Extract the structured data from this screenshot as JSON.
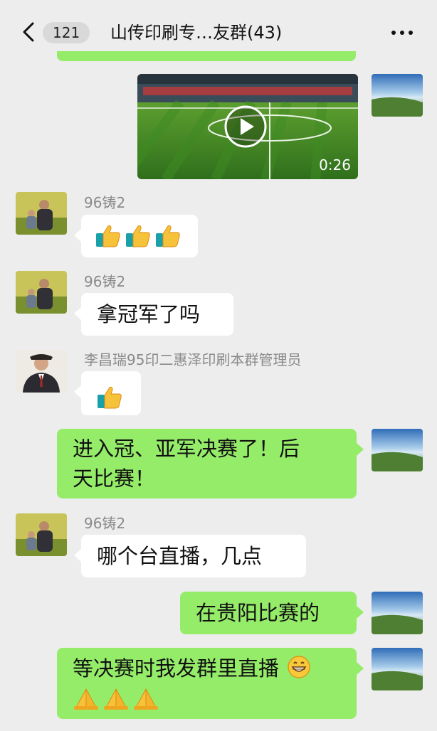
{
  "header": {
    "unread_count": "121",
    "title": "山传印刷专…友群(43)"
  },
  "messages": [
    {
      "type": "video",
      "from": "me",
      "duration": "0:26"
    },
    {
      "type": "emoji",
      "from": "other",
      "sender": "96铸2",
      "emojis": [
        "thumbs-up",
        "thumbs-up",
        "thumbs-up"
      ]
    },
    {
      "type": "text",
      "from": "other",
      "sender": "96铸2",
      "text": "拿冠军了吗"
    },
    {
      "type": "emoji",
      "from": "other",
      "sender": "李昌瑞95印二惠泽印刷本群管理员",
      "emojis": [
        "thumbs-up"
      ]
    },
    {
      "type": "text",
      "from": "me",
      "lines": [
        "进入冠、亚军决赛了！后",
        "天比赛！"
      ]
    },
    {
      "type": "text",
      "from": "other",
      "sender": "96铸2",
      "text": "哪个台直播，几点"
    },
    {
      "type": "text",
      "from": "me",
      "text": "在贵阳比赛的"
    },
    {
      "type": "text",
      "from": "me",
      "text": "等决赛时我发群里直播",
      "emojis": [
        "grin",
        "folded-hands",
        "folded-hands",
        "folded-hands"
      ]
    }
  ],
  "colors": {
    "outgoing_bubble": "#95ec69",
    "incoming_bubble": "#ffffff",
    "background": "#ededed"
  }
}
